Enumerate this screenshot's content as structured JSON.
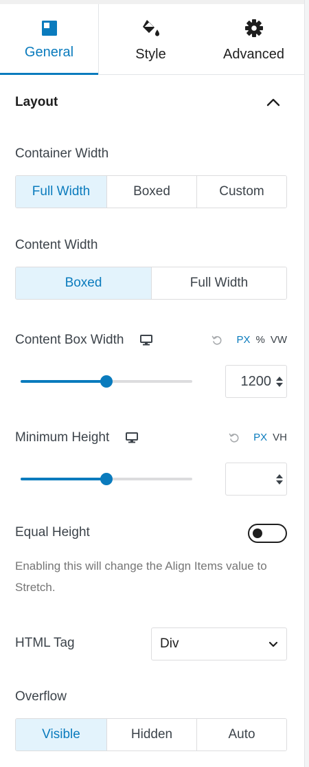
{
  "tabs": [
    {
      "label": "General",
      "icon": "layout-icon",
      "active": true
    },
    {
      "label": "Style",
      "icon": "paint-bucket-icon",
      "active": false
    },
    {
      "label": "Advanced",
      "icon": "gear-icon",
      "active": false
    }
  ],
  "panel": {
    "title": "Layout",
    "collapse_icon": "chevron-up-icon"
  },
  "container_width": {
    "label": "Container Width",
    "options": [
      "Full Width",
      "Boxed",
      "Custom"
    ],
    "selected": "Full Width"
  },
  "content_width": {
    "label": "Content Width",
    "options": [
      "Boxed",
      "Full Width"
    ],
    "selected": "Boxed"
  },
  "content_box_width": {
    "label": "Content Box Width",
    "device_icon": "desktop-icon",
    "reset_icon": "reset-icon",
    "units": [
      "PX",
      "%",
      "VW"
    ],
    "selected_unit": "PX",
    "value": "1200",
    "slider_fraction": 0.5
  },
  "minimum_height": {
    "label": "Minimum Height",
    "device_icon": "desktop-icon",
    "reset_icon": "reset-icon",
    "units": [
      "PX",
      "VH"
    ],
    "selected_unit": "PX",
    "value": "",
    "slider_fraction": 0.5
  },
  "equal_height": {
    "label": "Equal Height",
    "enabled": false,
    "help": "Enabling this will change the Align Items value to Stretch."
  },
  "html_tag": {
    "label": "HTML Tag",
    "value": "Div"
  },
  "overflow": {
    "label": "Overflow",
    "options": [
      "Visible",
      "Hidden",
      "Auto"
    ],
    "selected": "Visible"
  },
  "colors": {
    "accent": "#0a7bbd",
    "selected_bg": "#e3f3fc",
    "border": "#dcdcde"
  }
}
